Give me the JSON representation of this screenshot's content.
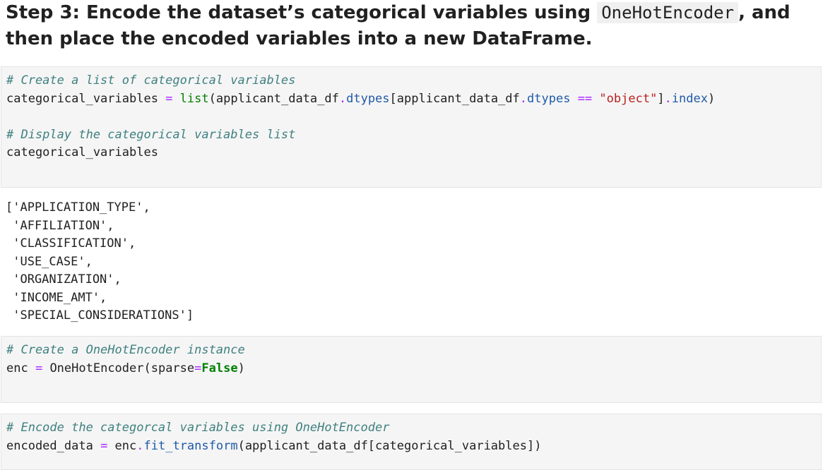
{
  "markdown": {
    "heading_before": "Step 3: Encode the dataset’s categorical variables using ",
    "heading_code": "OneHotEncoder",
    "heading_after": ", and then place the encoded variables into a new DataFrame."
  },
  "cells": [
    {
      "lines": [
        [
          {
            "t": "# Create a list of categorical variables",
            "c": "cm"
          }
        ],
        [
          {
            "t": "categorical_variables ",
            "c": "tx"
          },
          {
            "t": "=",
            "c": "op"
          },
          {
            "t": " ",
            "c": "tx"
          },
          {
            "t": "list",
            "c": "bi"
          },
          {
            "t": "(applicant_data_df",
            "c": "tx"
          },
          {
            "t": ".",
            "c": "op"
          },
          {
            "t": "dtypes",
            "c": "at"
          },
          {
            "t": "[applicant_data_df",
            "c": "tx"
          },
          {
            "t": ".",
            "c": "op"
          },
          {
            "t": "dtypes",
            "c": "at"
          },
          {
            "t": " ",
            "c": "tx"
          },
          {
            "t": "==",
            "c": "op"
          },
          {
            "t": " ",
            "c": "tx"
          },
          {
            "t": "\"object\"",
            "c": "st"
          },
          {
            "t": "]",
            "c": "tx"
          },
          {
            "t": ".",
            "c": "op"
          },
          {
            "t": "index",
            "c": "at"
          },
          {
            "t": ")",
            "c": "tx"
          }
        ],
        [],
        [
          {
            "t": "# Display the categorical variables list",
            "c": "cm"
          }
        ],
        [
          {
            "t": "categorical_variables",
            "c": "tx"
          }
        ]
      ],
      "output": "['APPLICATION_TYPE',\n 'AFFILIATION',\n 'CLASSIFICATION',\n 'USE_CASE',\n 'ORGANIZATION',\n 'INCOME_AMT',\n 'SPECIAL_CONSIDERATIONS']"
    },
    {
      "lines": [
        [
          {
            "t": "# Create a OneHotEncoder instance",
            "c": "cm"
          }
        ],
        [
          {
            "t": "enc ",
            "c": "tx"
          },
          {
            "t": "=",
            "c": "op"
          },
          {
            "t": " OneHotEncoder(sparse",
            "c": "tx"
          },
          {
            "t": "=",
            "c": "op"
          },
          {
            "t": "False",
            "c": "kw"
          },
          {
            "t": ")",
            "c": "tx"
          }
        ]
      ]
    },
    {
      "lines": [
        [
          {
            "t": "# Encode the categorcal variables using OneHotEncoder",
            "c": "cm"
          }
        ],
        [
          {
            "t": "encoded_data ",
            "c": "tx"
          },
          {
            "t": "=",
            "c": "op"
          },
          {
            "t": " enc",
            "c": "tx"
          },
          {
            "t": ".",
            "c": "op"
          },
          {
            "t": "fit_transform",
            "c": "at"
          },
          {
            "t": "(applicant_data_df[categorical_variables])",
            "c": "tx"
          }
        ]
      ]
    }
  ]
}
